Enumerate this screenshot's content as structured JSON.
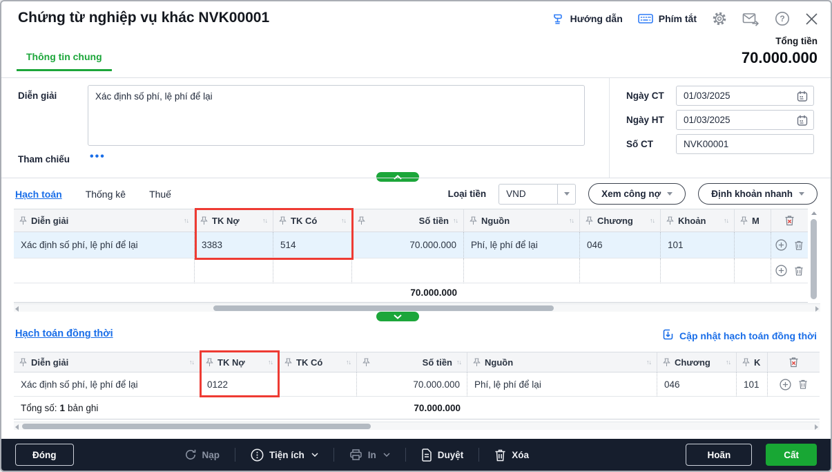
{
  "window": {
    "title": "Chứng từ nghiệp vụ khác NVK00001"
  },
  "header": {
    "huong_dan": "Hướng dẫn",
    "phim_tat": "Phím tắt"
  },
  "totals": {
    "label": "Tổng tiền",
    "value": "70.000.000"
  },
  "tab": {
    "label": "Thông tin chung"
  },
  "form": {
    "dien_giai_label": "Diễn giải",
    "dien_giai_value": "Xác định số phí, lệ phí để lại",
    "tham_chieu_label": "Tham chiếu",
    "tham_chieu_dots": "•••",
    "ngay_ct_label": "Ngày CT",
    "ngay_ct_value": "01/03/2025",
    "ngay_ht_label": "Ngày HT",
    "ngay_ht_value": "01/03/2025",
    "so_ct_label": "Số CT",
    "so_ct_value": "NVK00001"
  },
  "section1": {
    "tab_hach_toan": "Hạch toán",
    "tab_thong_ke": "Thống kê",
    "tab_thue": "Thuế",
    "loai_tien_label": "Loại tiền",
    "loai_tien_value": "VND",
    "xem_cong_no": "Xem công nợ",
    "dinh_khoan_nhanh": "Định khoản nhanh",
    "table": {
      "columns": [
        "Diễn giải",
        "TK Nợ",
        "TK Có",
        "Số tiền",
        "Nguồn",
        "Chương",
        "Khoản",
        "M"
      ],
      "rows": [
        [
          "Xác định số phí, lệ phí để lại",
          "3383",
          "514",
          "70.000.000",
          "Phí, lệ phí để lại",
          "046",
          "101",
          ""
        ]
      ],
      "total": "70.000.000"
    }
  },
  "section2": {
    "title": "Hạch toán đồng thời",
    "update_link": "Cập nhật hạch toán đồng thời",
    "table": {
      "columns": [
        "Diễn giải",
        "TK Nợ",
        "TK Có",
        "Số tiền",
        "Nguồn",
        "Chương",
        "K"
      ],
      "rows": [
        [
          "Xác định số phí, lệ phí để lại",
          "0122",
          "",
          "70.000.000",
          "Phí, lệ phí để lại",
          "046",
          "101"
        ]
      ],
      "total_prefix": "Tổng số:",
      "total_count": "1",
      "total_suffix": "bản ghi",
      "total": "70.000.000"
    }
  },
  "footer": {
    "dong": "Đóng",
    "nap": "Nạp",
    "tien_ich": "Tiện ích",
    "in": "In",
    "duyet": "Duyệt",
    "xoa": "Xóa",
    "hoan": "Hoãn",
    "cat": "Cất"
  },
  "colors": {
    "accent_green": "#1ca63a",
    "link_blue": "#1a6ee8",
    "annotation_red": "#ee3b33",
    "footer_bg": "#161e2d",
    "selected_row": "#e7f3fd"
  }
}
